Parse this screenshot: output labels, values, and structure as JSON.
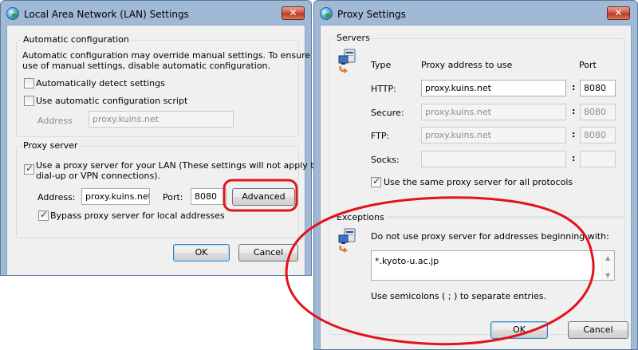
{
  "lan": {
    "title": "Local Area Network (LAN) Settings",
    "close": "✕",
    "auto_group": "Automatic configuration",
    "auto_desc_1": "Automatic configuration may override manual settings.  To ensure the",
    "auto_desc_2": "use of manual settings, disable automatic configuration.",
    "auto_detect": "Automatically detect settings",
    "auto_script": "Use automatic configuration script",
    "address_label": "Address",
    "address_value": "proxy.kuins.net",
    "proxy_group": "Proxy server",
    "use_proxy_1": "Use a proxy server for your LAN (These settings will not apply to",
    "use_proxy_2": "dial-up or VPN connections).",
    "address_label2": "Address:",
    "address_value2": "proxy.kuins.net",
    "port_label": "Port:",
    "port_value": "8080",
    "advanced": "Advanced",
    "bypass": "Bypass proxy server for local addresses",
    "ok": "OK",
    "cancel": "Cancel"
  },
  "proxy": {
    "title": "Proxy Settings",
    "close": "✕",
    "servers_group": "Servers",
    "type_header": "Type",
    "address_header": "Proxy address to use",
    "port_header": "Port",
    "colon": ":",
    "rows": [
      {
        "label": "HTTP:",
        "address": "proxy.kuins.net",
        "port": "8080"
      },
      {
        "label": "Secure:",
        "address": "proxy.kuins.net",
        "port": "8080"
      },
      {
        "label": "FTP:",
        "address": "proxy.kuins.net",
        "port": "8080"
      },
      {
        "label": "Socks:",
        "address": "",
        "port": ""
      }
    ],
    "same_proxy": "Use the same proxy server for all protocols",
    "exceptions_group": "Exceptions",
    "exceptions_desc": "Do not use proxy server for addresses beginning with:",
    "exceptions_value": "*.kyoto-u.ac.jp",
    "exceptions_hint": "Use semicolons ( ; ) to separate entries.",
    "ok": "OK",
    "cancel": "Cancel"
  },
  "colors": {
    "annotation": "#e0141b",
    "frame": "#9fb9d6",
    "client": "#f0f0f0"
  }
}
